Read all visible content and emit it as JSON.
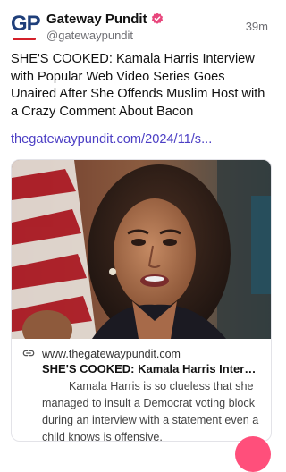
{
  "account": {
    "name": "Gateway Pundit",
    "handle": "@gatewaypundit",
    "avatar_text": "GP",
    "verified_color": "#e8467c"
  },
  "post": {
    "time": "39m",
    "text": "SHE'S COOKED: Kamala Harris Interview with Popular Web Video Series Goes Unaired After She Offends Muslim Host with a Crazy Comment About Bacon",
    "link_text": "thegatewaypundit.com/2024/11/s..."
  },
  "card": {
    "domain": "www.thegatewaypundit.com",
    "title": "SHE'S COOKED: Kamala Harris Intervi...",
    "description": "Kamala Harris is so clueless that she managed to insult a Democrat voting block during an interview with a statement even a child knows is offensive.",
    "icon": "link-icon"
  },
  "colors": {
    "link": "#4b3ec4",
    "fab": "#ff4f7b"
  }
}
